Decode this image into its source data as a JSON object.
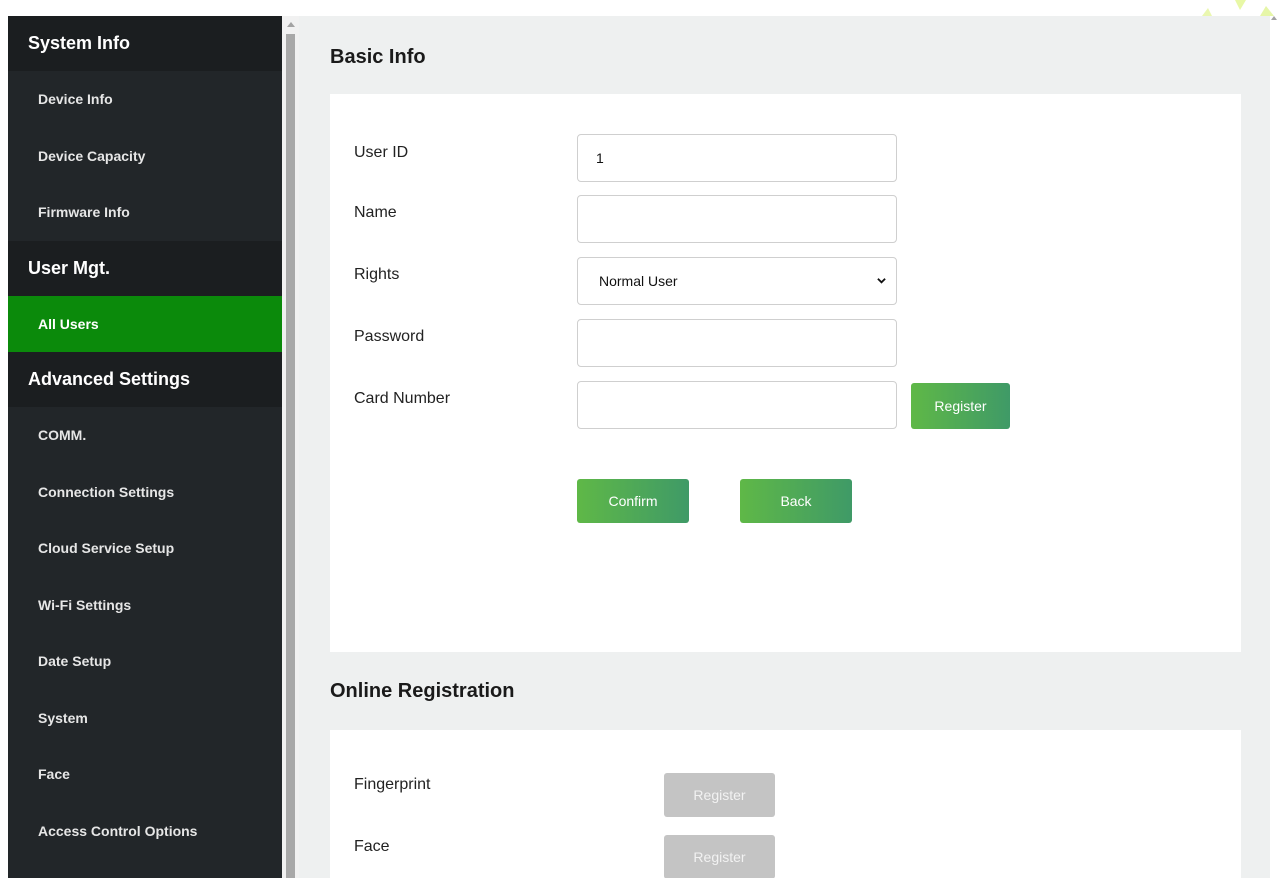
{
  "sidebar": {
    "sections": [
      {
        "title": "System Info",
        "items": [
          "Device Info",
          "Device Capacity",
          "Firmware Info"
        ]
      },
      {
        "title": "User Mgt.",
        "items": [
          "All Users"
        ]
      },
      {
        "title": "Advanced Settings",
        "items": [
          "COMM.",
          "Connection Settings",
          "Cloud Service Setup",
          "Wi-Fi Settings",
          "Date Setup",
          "System",
          "Face",
          "Access Control Options"
        ]
      }
    ],
    "active_item": "All Users"
  },
  "basic_info": {
    "title": "Basic Info",
    "user_id_label": "User ID",
    "user_id_value": "1",
    "name_label": "Name",
    "name_value": "",
    "rights_label": "Rights",
    "rights_value": "Normal User",
    "password_label": "Password",
    "password_value": "",
    "card_number_label": "Card Number",
    "card_number_value": "",
    "register_label": "Register",
    "confirm_label": "Confirm",
    "back_label": "Back"
  },
  "online_registration": {
    "title": "Online Registration",
    "fingerprint_label": "Fingerprint",
    "fingerprint_button": "Register",
    "face_label": "Face",
    "face_button": "Register"
  },
  "colors": {
    "sidebar_bg": "#222629",
    "sidebar_header_bg": "#1b1e20",
    "active_item_bg": "#0b8a0b",
    "button_green_start": "#5fb847",
    "button_green_end": "#3f9a67",
    "button_disabled": "#c4c4c4",
    "main_bg": "#eef0f0"
  },
  "icons": {
    "select_arrow": "chevron-down-icon",
    "scroll_up": "scroll-up-arrow-icon"
  }
}
